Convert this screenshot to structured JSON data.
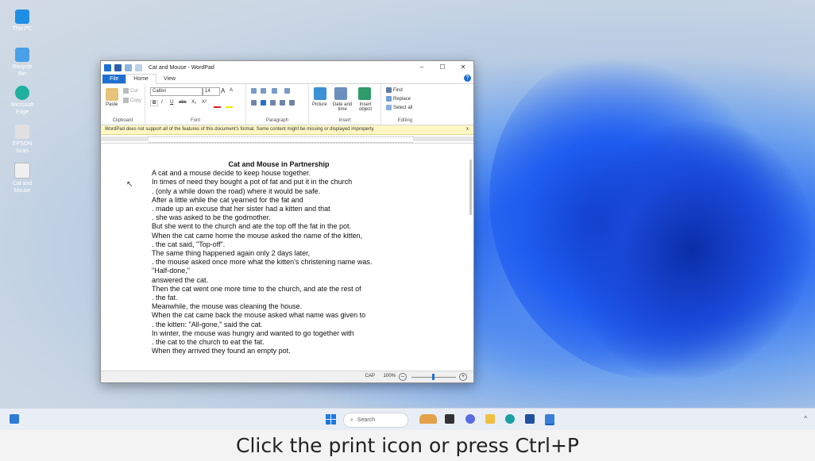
{
  "desktop": {
    "icons": [
      {
        "label": "This PC",
        "color": "#1f8fe6"
      },
      {
        "label": "Recycle Bin",
        "color": "#4aa0e8"
      },
      {
        "label": "Microsoft Edge",
        "color": "#1fb0a0"
      },
      {
        "label": "EPSON Scan",
        "color": "#e0e0e0"
      },
      {
        "label": "Cat and Mouse",
        "color": "#f0f0f0"
      }
    ]
  },
  "window": {
    "title": "Cat and Mouse - WordPad",
    "controls": {
      "minimize": "–",
      "maximize": "☐",
      "close": "✕"
    },
    "tabs": {
      "file": "File",
      "home": "Home",
      "view": "View"
    },
    "help": "?",
    "ribbon": {
      "clipboard": {
        "label": "Clipboard",
        "paste": "Paste",
        "cut": "Cut",
        "copy": "Copy"
      },
      "font": {
        "label": "Font",
        "family": "Calibri",
        "size": "14",
        "grow": "A",
        "shrink": "A",
        "bold": "B",
        "italic": "I",
        "underline": "U",
        "strike": "abc",
        "subscript": "X₂",
        "superscript": "X²"
      },
      "paragraph": {
        "label": "Paragraph"
      },
      "insert": {
        "label": "Insert",
        "picture": "Picture",
        "datetime": "Date and time",
        "object": "Insert object"
      },
      "editing": {
        "label": "Editing",
        "find": "Find",
        "replace": "Replace",
        "select_all": "Select all"
      }
    },
    "infobar": {
      "message": "WordPad does not support all of the features of this document's format. Some content might be missing or displayed improperly.",
      "close": "x"
    },
    "document": {
      "title": "Cat and Mouse in Partnership",
      "lines": [
        "A cat and a mouse decide to keep house together.",
        "In times of need they bought a pot of fat and put it in the church",
        ". (only a while down the road) where it would be safe.",
        "After a little while the cat yearned for the fat and",
        ". made up an excuse that her sister had a kitten and that",
        ". she was asked to be the godmother.",
        "But she went to the church and ate the top off the fat in the pot.",
        "When the cat came home the mouse asked the name of the kitten,",
        ". the cat said, \"Top-off\".",
        "The same thing happened again only 2 days later,",
        ". the mouse asked once more what the kitten's christening name was.",
        "\"Half-done,\"",
        "answered the cat.",
        "Then the cat went one more time to the church, and ate the rest of",
        ". the fat.",
        "Meanwhile, the mouse was cleaning the house.",
        "When the cat came back the mouse asked what name was given to",
        ". the kitten: \"All-gone,\" said the cat.",
        "In winter, the mouse was hungry and wanted to go together with",
        ". the cat to the church to eat the fat.",
        "When they arrived they found an empty pot."
      ]
    },
    "status": {
      "caps": "CAP",
      "zoom": "100%",
      "zoom_out": "–",
      "zoom_in": "+"
    }
  },
  "taskbar": {
    "search_placeholder": "Search",
    "apps": [
      {
        "name": "landscape",
        "color": "#e3a24a"
      },
      {
        "name": "task-view",
        "color": "#333333"
      },
      {
        "name": "chat",
        "color": "#5a6be0"
      },
      {
        "name": "file-explorer",
        "color": "#f0c040"
      },
      {
        "name": "edge",
        "color": "#1aa0a0"
      },
      {
        "name": "store",
        "color": "#2050a0"
      },
      {
        "name": "wordpad",
        "color": "#3a7fd8"
      }
    ],
    "caret": "^"
  },
  "caption": "Click the print icon or press Ctrl+P"
}
